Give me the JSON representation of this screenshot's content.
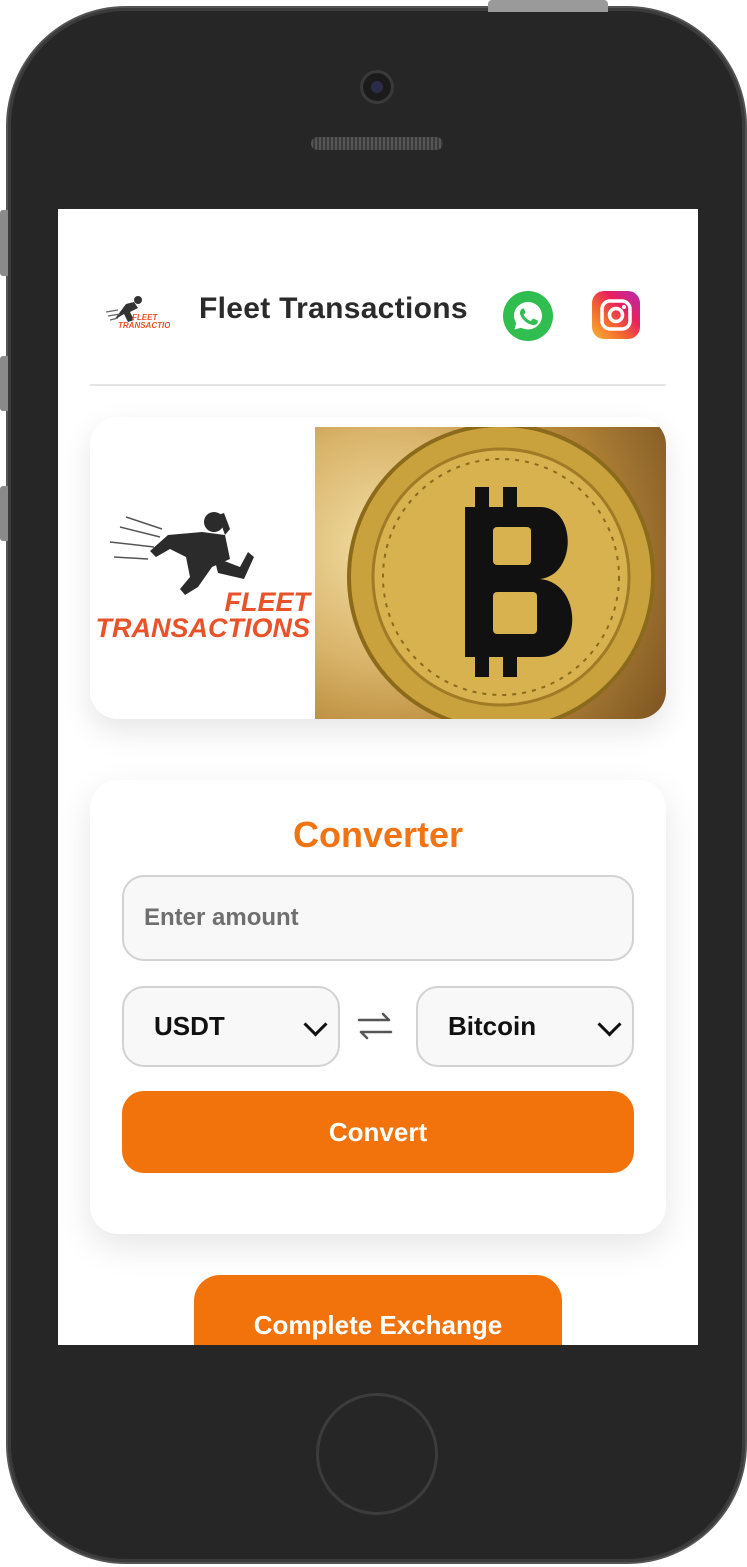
{
  "header": {
    "brand": "Fleet Transactions",
    "logo_label": "FLEET TRANSACTIONS",
    "whatsapp_icon": "whatsapp-icon",
    "instagram_icon": "instagram-icon"
  },
  "banner": {
    "logo_line1": "FLEET",
    "logo_line2": "TRANSACTIONS",
    "coin_icon": "bitcoin-coin-icon"
  },
  "converter": {
    "title": "Converter",
    "amount_placeholder": "Enter amount",
    "from_currency": "USDT",
    "to_currency": "Bitcoin",
    "swap_icon": "swap-arrows-icon",
    "convert_label": "Convert"
  },
  "bottom_button": {
    "label": "Complete Exchange"
  },
  "colors": {
    "accent": "#f2730b",
    "title": "#f07314",
    "whatsapp": "#2fbe4f"
  }
}
